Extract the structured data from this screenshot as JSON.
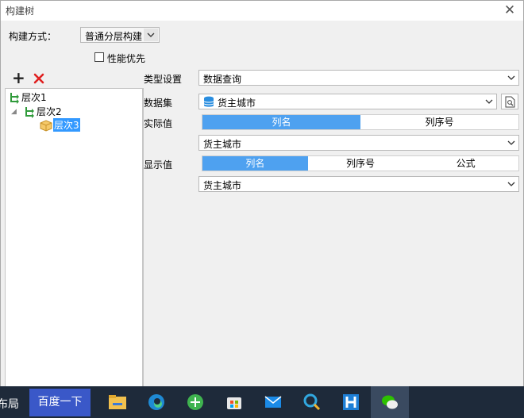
{
  "window": {
    "title": "构建树"
  },
  "build": {
    "label": "构建方式：",
    "value": "普通分层构建"
  },
  "perf": {
    "label": "性能优先",
    "checked": false
  },
  "tree": {
    "nodes": [
      "层次1",
      "层次2",
      "层次3"
    ],
    "selected_index": 2
  },
  "form": {
    "type_label": "类型设置",
    "type_value": "数据查询",
    "dataset_label": "数据集",
    "dataset_value": "货主城市",
    "actual_label": "实际值",
    "actual_tabs": [
      "列名",
      "列序号"
    ],
    "actual_value": "货主城市",
    "display_label": "显示值",
    "display_tabs": [
      "列名",
      "列序号",
      "公式"
    ],
    "display_value": "货主城市"
  },
  "taskbar": {
    "left_text": "布局",
    "search_button": "百度一下"
  },
  "colors": {
    "accent": "#4ea1f0",
    "selection": "#3399ff",
    "delete": "#e02020"
  }
}
